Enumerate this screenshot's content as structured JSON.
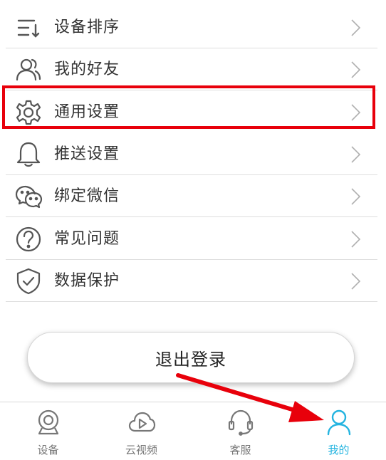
{
  "menu": {
    "items": [
      {
        "label": "设备排序",
        "icon": "sort-list-icon"
      },
      {
        "label": "我的好友",
        "icon": "friends-icon"
      },
      {
        "label": "通用设置",
        "icon": "gear-icon"
      },
      {
        "label": "推送设置",
        "icon": "bell-icon"
      },
      {
        "label": "绑定微信",
        "icon": "wechat-icon"
      },
      {
        "label": "常见问题",
        "icon": "question-circle-icon"
      },
      {
        "label": "数据保护",
        "icon": "shield-check-icon"
      }
    ]
  },
  "logout": {
    "label": "退出登录"
  },
  "tabbar": {
    "tabs": [
      {
        "label": "设备",
        "icon": "camera-device-icon"
      },
      {
        "label": "云视频",
        "icon": "cloud-play-icon"
      },
      {
        "label": "客服",
        "icon": "headset-icon"
      },
      {
        "label": "我的",
        "icon": "person-icon"
      }
    ],
    "active": "我的"
  },
  "colors": {
    "accent": "#24b4e0",
    "highlight": "#e8000b",
    "text": "#333333",
    "icon_gray": "#555555",
    "divider": "#dedede"
  }
}
